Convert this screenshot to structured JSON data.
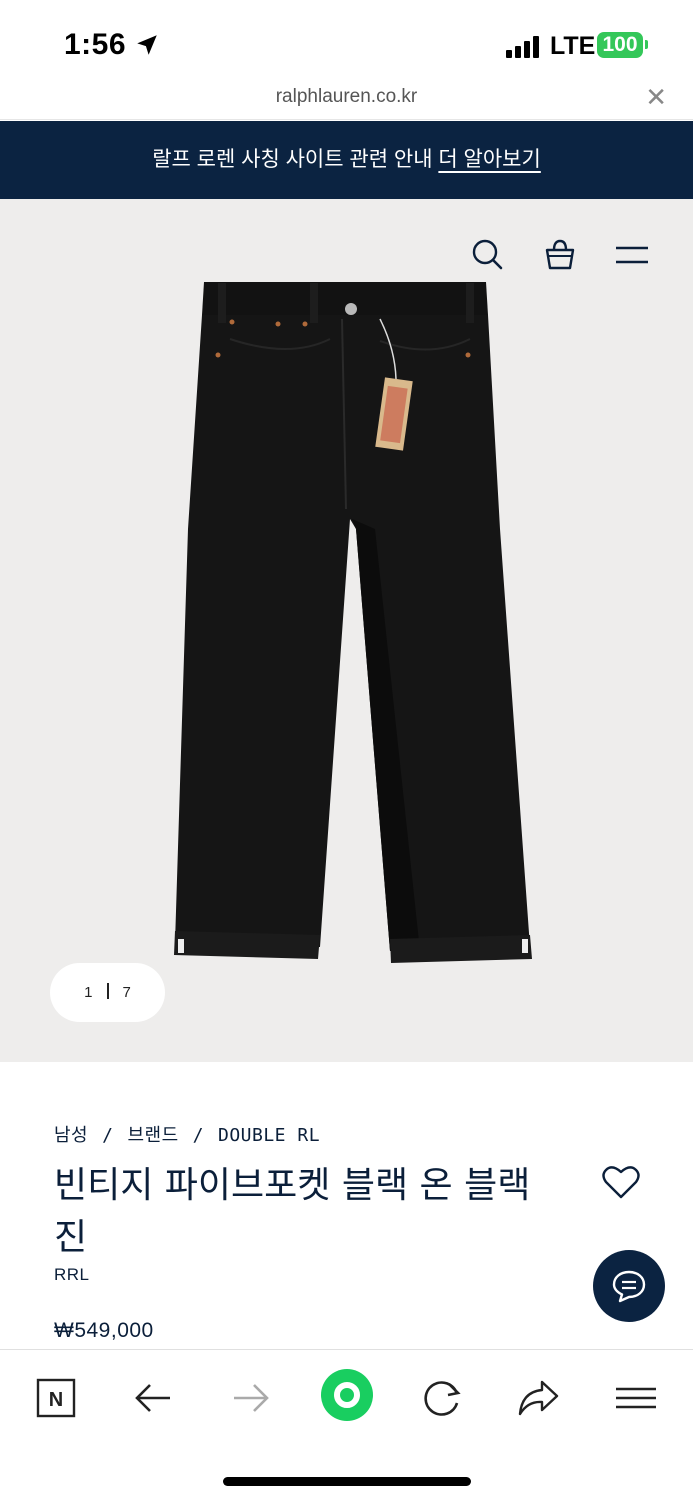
{
  "status_bar": {
    "time": "1:56",
    "network": "LTE",
    "battery": "100",
    "battery_color": "#34c759"
  },
  "browser": {
    "url": "ralphlauren.co.kr",
    "close_icon": "close-icon"
  },
  "notice": {
    "text": "랄프 로렌 사칭 사이트 관련 안내",
    "link": "더 알아보기",
    "background": "#0b2341"
  },
  "header_icons": [
    "search-icon",
    "shopping-bag-icon",
    "menu-icon"
  ],
  "gallery": {
    "current": "1",
    "total": "7"
  },
  "breadcrumb": {
    "items": [
      "남성",
      "브랜드",
      "DOUBLE RL"
    ],
    "separator": "/"
  },
  "product": {
    "title": "빈티지 파이브포켓 블랙 온 블랙 진",
    "brand": "RRL",
    "price": "₩549,000"
  },
  "toolbar": {
    "items": [
      "naver-icon",
      "back-arrow-icon",
      "forward-arrow-icon",
      "green-dot-icon",
      "reload-icon",
      "share-icon",
      "menu-icon"
    ],
    "naver_letter": "N",
    "accent": "#19ce60"
  }
}
